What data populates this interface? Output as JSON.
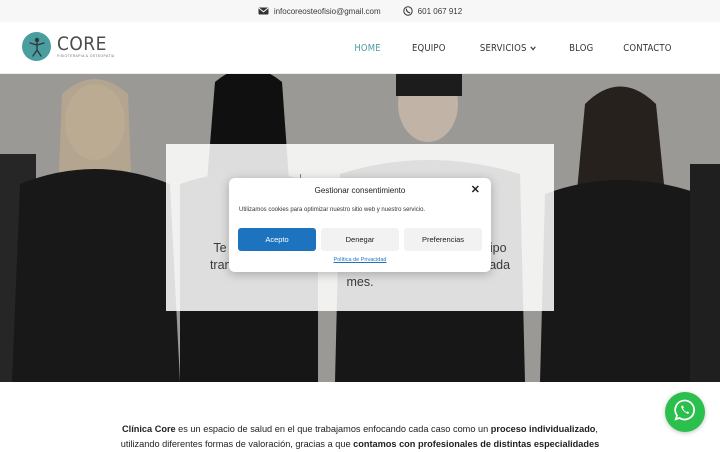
{
  "topbar": {
    "email": "infocoreosteofisio@gmail.com",
    "phone": "601 067 912",
    "email_icon": "envelope-icon",
    "phone_icon": "whatsapp-icon"
  },
  "brand": {
    "name": "CORE",
    "tagline": "FISIOTERAPIA & OSTEOPATIA",
    "accent": "#4a9ea0"
  },
  "nav": {
    "items": [
      {
        "label": "HOME",
        "active": true
      },
      {
        "label": "EQUIPO",
        "active": false
      },
      {
        "label": "SERVICIOS",
        "active": false,
        "dropdown": true
      },
      {
        "label": "BLOG",
        "active": false
      },
      {
        "label": "CONTACTO",
        "active": false
      }
    ]
  },
  "hero": {
    "text_line1": "Te ayu                                                               equipo",
    "text_line2": "transdis                                                              te cada",
    "text_line3": "mes."
  },
  "consent": {
    "title": "Gestionar consentimiento",
    "body": "Utilizamos cookies para optimizar nuestro sitio web y nuestro servicio.",
    "accept": "Acepto",
    "deny": "Denegar",
    "preferences": "Preferencias",
    "policy_link": "Política de Privacidad",
    "close_icon": "close-icon",
    "accept_color": "#1e73be"
  },
  "intro": {
    "part1": "Clínica Core",
    "part2": " es un espacio de salud en el que trabajamos enfocando cada caso como un ",
    "part3": "proceso individualizado",
    "part4": ", utilizando diferentes formas de valoración, gracias a que ",
    "part5": "contamos con profesionales de distintas especialidades"
  },
  "floating": {
    "icon": "whatsapp-icon",
    "color": "#2bbf4e"
  }
}
